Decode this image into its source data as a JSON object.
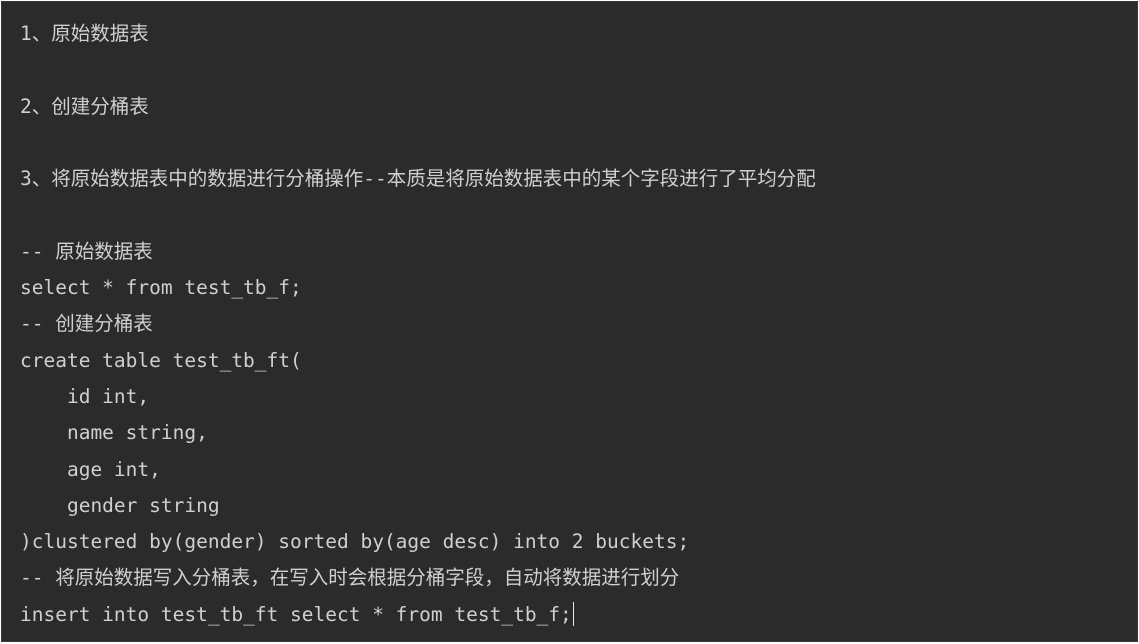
{
  "editor": {
    "colors": {
      "background": "#2b2b2b",
      "text": "#cfcfcf",
      "caret": "#e8e8e8"
    },
    "lines": [
      "1、原始数据表",
      "",
      "2、创建分桶表",
      "",
      "3、将原始数据表中的数据进行分桶操作--本质是将原始数据表中的某个字段进行了平均分配",
      "",
      "-- 原始数据表",
      "select * from test_tb_f;",
      "-- 创建分桶表",
      "create table test_tb_ft(",
      "    id int,",
      "    name string,",
      "    age int,",
      "    gender string",
      ")clustered by(gender) sorted by(age desc) into 2 buckets;",
      "-- 将原始数据写入分桶表，在写入时会根据分桶字段，自动将数据进行划分",
      "insert into test_tb_ft select * from test_tb_f;"
    ]
  }
}
